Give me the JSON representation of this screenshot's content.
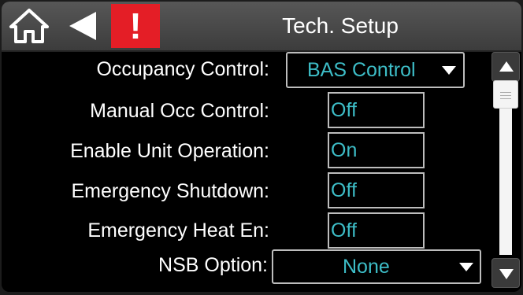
{
  "header": {
    "title": "Tech. Setup",
    "alert_symbol": "!",
    "icons": [
      "home-icon",
      "back-arrow-icon",
      "alert-icon"
    ],
    "alert_color": "#e41e26"
  },
  "settings": [
    {
      "label": "Occupancy Control:",
      "value": "BAS Control",
      "type": "dropdown"
    },
    {
      "label": "Manual Occ Control:",
      "value": "Off",
      "type": "value"
    },
    {
      "label": "Enable Unit Operation:",
      "value": "On",
      "type": "value"
    },
    {
      "label": "Emergency Shutdown:",
      "value": "Off",
      "type": "value"
    },
    {
      "label": "Emergency Heat En:",
      "value": "Off",
      "type": "value"
    },
    {
      "label": "NSB Option:",
      "value": "None",
      "type": "dropdown"
    }
  ],
  "colors": {
    "value_text": "#3dbdc7",
    "label_text": "#ffffff",
    "background": "#000000"
  }
}
